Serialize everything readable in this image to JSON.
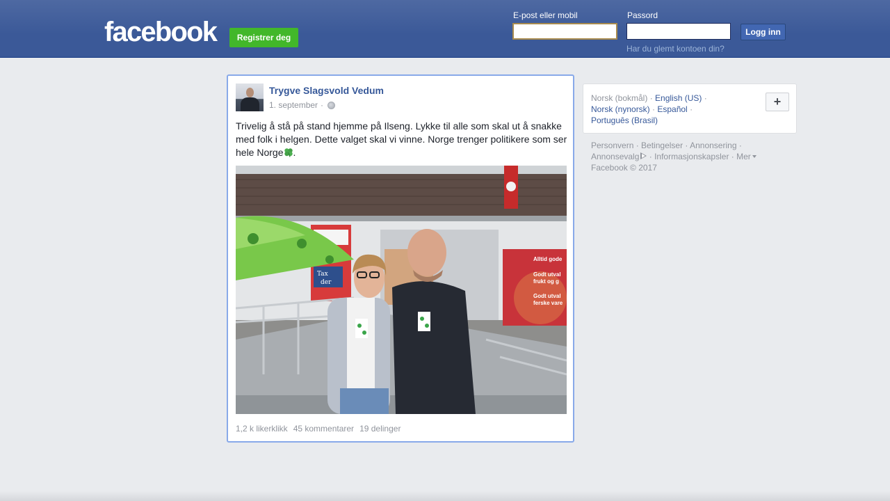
{
  "header": {
    "logo": "facebook",
    "register_label": "Registrer deg",
    "email_label": "E-post eller mobil",
    "email_value": "",
    "password_label": "Passord",
    "password_value": "",
    "login_label": "Logg inn",
    "forgot_label": "Har du glemt kontoen din?"
  },
  "post": {
    "author": "Trygve Slagsvold Vedum",
    "date": "1. september",
    "separator": "·",
    "privacy_icon": "globe-icon",
    "text_main": "Trivelig å stå på stand hjemme på Ilseng. Lykke til alle som skal ut å snakke med folk i helgen. Dette valget skal vi vinne. Norge trenger politikere som ser hele Norge",
    "text_end": ".",
    "emoji": "four-leaf-clover-icon",
    "stats": {
      "likes": "1,2 k likerklikk",
      "comments": "45 kommentarer",
      "shares": "19 delinger"
    },
    "photo_signs": {
      "sign_left_1": "Tax",
      "sign_left_2": "der",
      "sign_right_1": "Alltid gode",
      "sign_right_2": "Godt utval",
      "sign_right_3": "frukt og g",
      "sign_right_4": "Godt utval",
      "sign_right_5": "ferske vare"
    }
  },
  "languages": {
    "current": "Norsk (bokmål)",
    "items": [
      "English (US)",
      "Norsk (nynorsk)",
      "Español",
      "Português (Brasil)"
    ],
    "more_button": "+"
  },
  "footer": {
    "links": [
      "Personvern",
      "Betingelser",
      "Annonsering",
      "Annonsevalg",
      "Informasjonskapsler",
      "Mer"
    ],
    "copyright": "Facebook © 2017"
  },
  "colors": {
    "brand_blue": "#3b5998",
    "link_blue": "#365899",
    "register_green": "#42b72a",
    "focus_border": "#88a9e9"
  }
}
